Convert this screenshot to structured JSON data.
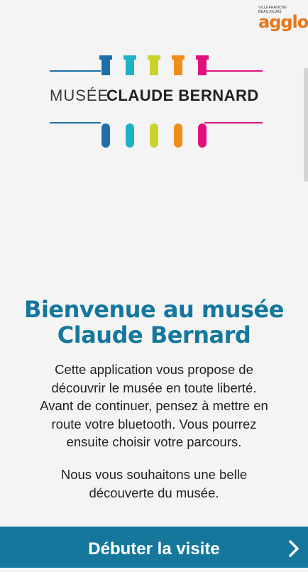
{
  "brand": {
    "agglo_small_text": "VILLEFRANCHE BEAUJOLAIS",
    "agglo_big_text": "agglo"
  },
  "logo": {
    "text_part1": "MUSÉE",
    "text_part2": "CLAUDE BERNARD",
    "tube_colors": [
      "#1e6fa8",
      "#1fb2c4",
      "#c8d42a",
      "#f28c1c",
      "#e0117c"
    ]
  },
  "welcome": {
    "title_line1": "Bienvenue au musée",
    "title_line2": "Claude Bernard",
    "paragraph_lines": [
      "Cette application vous propose de",
      "découvrir le musée en toute liberté.",
      "Avant de continuer, pensez à mettre en",
      "route votre bluetooth. Vous pourrez",
      "ensuite choisir votre parcours."
    ],
    "wish_lines": [
      "Nous vous souhaitons une belle",
      "découverte du musée."
    ]
  },
  "action": {
    "start_label": "Débuter la visite",
    "icon": "chevron-right-icon"
  },
  "colors": {
    "accent": "#15779c",
    "background": "#f4f4f4"
  }
}
